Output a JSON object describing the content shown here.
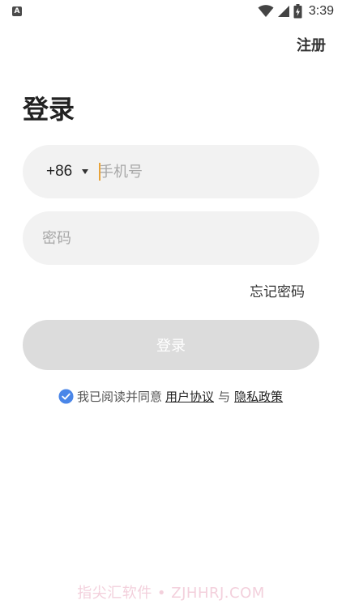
{
  "status_bar": {
    "app_icon_letter": "A",
    "time": "3:39"
  },
  "header": {
    "register_label": "注册"
  },
  "page": {
    "title": "登录"
  },
  "phone_field": {
    "country_code": "+86",
    "placeholder": "手机号",
    "value": ""
  },
  "password_field": {
    "placeholder": "密码",
    "value": ""
  },
  "forgot_password_label": "忘记密码",
  "login_button_label": "登录",
  "agreement": {
    "checked": true,
    "prefix": "我已阅读并同意",
    "user_agreement": "用户协议",
    "connector": "与",
    "privacy_policy": "隐私政策"
  },
  "watermark": "指尖汇软件 • ZJHHRJ.COM",
  "icons": {
    "wifi": "wifi-icon",
    "signal": "signal-icon",
    "battery": "battery-icon",
    "dropdown": "caret-down-icon",
    "check": "check-circle-icon"
  },
  "colors": {
    "accent": "#4a86e8",
    "button_disabled": "#dcdcdc",
    "field_bg": "#f2f2f2",
    "cursor": "#e8a33a",
    "watermark": "#f3d0dc"
  }
}
